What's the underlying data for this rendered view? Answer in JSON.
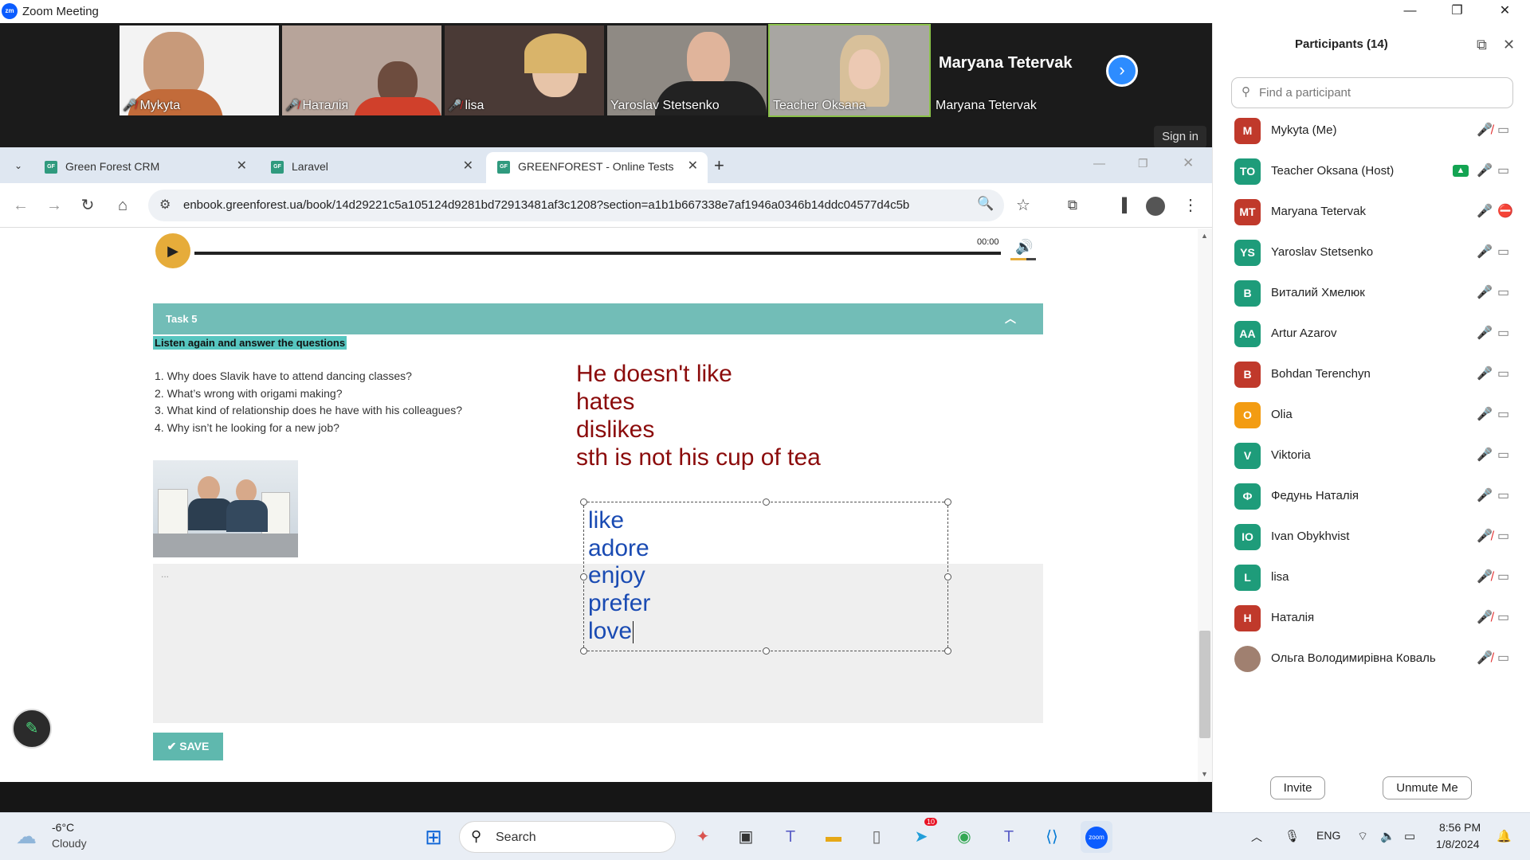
{
  "window": {
    "title": "Zoom Meeting"
  },
  "video_tiles": [
    {
      "name": "Mykyta",
      "muted": true
    },
    {
      "name": "Наталія",
      "muted": true
    },
    {
      "name": "lisa",
      "muted": true
    },
    {
      "name": "Yaroslav Stetsenko",
      "muted": false
    },
    {
      "name": "Teacher Oksana",
      "muted": false
    },
    {
      "name": "Maryana Tetervak",
      "muted": false,
      "big_name": "Maryana Tetervak"
    }
  ],
  "sign_in": "Sign in",
  "browser": {
    "tabs": [
      {
        "label": "Green Forest CRM",
        "fav": "GF"
      },
      {
        "label": "Laravel",
        "fav": "GF"
      },
      {
        "label": "GREENFOREST - Online Tests",
        "fav": "GF"
      }
    ],
    "url": "enbook.greenforest.ua/book/14d29221c5a105124d9281bd72913481af3c1208?section=a1b1b667338e7af1946a0346b14ddc04577d4c5b"
  },
  "player": {
    "time": "00:00",
    "progress": 0
  },
  "task": {
    "header": "Task 5",
    "instruction": "Listen again and answer the questions",
    "questions": [
      "1. Why does Slavik have to attend dancing classes?",
      "2. What’s wrong with origami making?",
      "3. What kind of relationship does he have with his colleagues?",
      "4. Why isn’t he looking for a new job?"
    ],
    "answer_placeholder": "...",
    "save": "SAVE"
  },
  "annotations": {
    "red_lines": [
      "He doesn't like",
      "hates",
      "dislikes",
      "sth is not his cup of tea"
    ],
    "blue_lines": [
      "like",
      "adore",
      "enjoy",
      "prefer",
      "love"
    ]
  },
  "participants": {
    "header": "Participants (14)",
    "search_placeholder": "Find a participant",
    "list": [
      {
        "initials": "M",
        "name": "Mykyta (Me)",
        "color": "#c0392b",
        "mic": "muted",
        "cam": "on"
      },
      {
        "initials": "TO",
        "name": "Teacher Oksana (Host)",
        "color": "#1e9c7a",
        "mic": "on",
        "cam": "on",
        "sharing": true
      },
      {
        "initials": "MT",
        "name": "Maryana Tetervak",
        "color": "#c0392b",
        "mic": "on",
        "cam": "off"
      },
      {
        "initials": "YS",
        "name": "Yaroslav Stetsenko",
        "color": "#1e9c7a",
        "mic": "on",
        "cam": "on"
      },
      {
        "initials": "В",
        "name": "Виталий Хмелюк",
        "color": "#1e9c7a",
        "mic": "on",
        "cam": "on"
      },
      {
        "initials": "AA",
        "name": "Artur Azarov",
        "color": "#1e9c7a",
        "mic": "on",
        "cam": "on"
      },
      {
        "initials": "B",
        "name": "Bohdan Terenchyn",
        "color": "#c0392b",
        "mic": "on",
        "cam": "on"
      },
      {
        "initials": "O",
        "name": "Olia",
        "color": "#f39c12",
        "mic": "on",
        "cam": "on"
      },
      {
        "initials": "V",
        "name": "Viktoria",
        "color": "#1e9c7a",
        "mic": "on",
        "cam": "on"
      },
      {
        "initials": "Ф",
        "name": "Федунь Наталія",
        "color": "#1e9c7a",
        "mic": "on",
        "cam": "on"
      },
      {
        "initials": "IO",
        "name": "Ivan Obykhvist",
        "color": "#1e9c7a",
        "mic": "muted",
        "cam": "on"
      },
      {
        "initials": "L",
        "name": "lisa",
        "color": "#1e9c7a",
        "mic": "muted",
        "cam": "on"
      },
      {
        "initials": "H",
        "name": "Наталія",
        "color": "#c0392b",
        "mic": "muted",
        "cam": "on"
      },
      {
        "initials": "",
        "name": "Ольга Володимирівна Коваль",
        "color": "#a08070",
        "mic": "muted",
        "cam": "on"
      }
    ],
    "invite": "Invite",
    "unmute": "Unmute Me"
  },
  "taskbar": {
    "weather_temp": "-6°C",
    "weather_desc": "Cloudy",
    "search": "Search",
    "lang": "ENG",
    "time": "8:56 PM",
    "date": "1/8/2024",
    "telegram_badge": "10"
  }
}
